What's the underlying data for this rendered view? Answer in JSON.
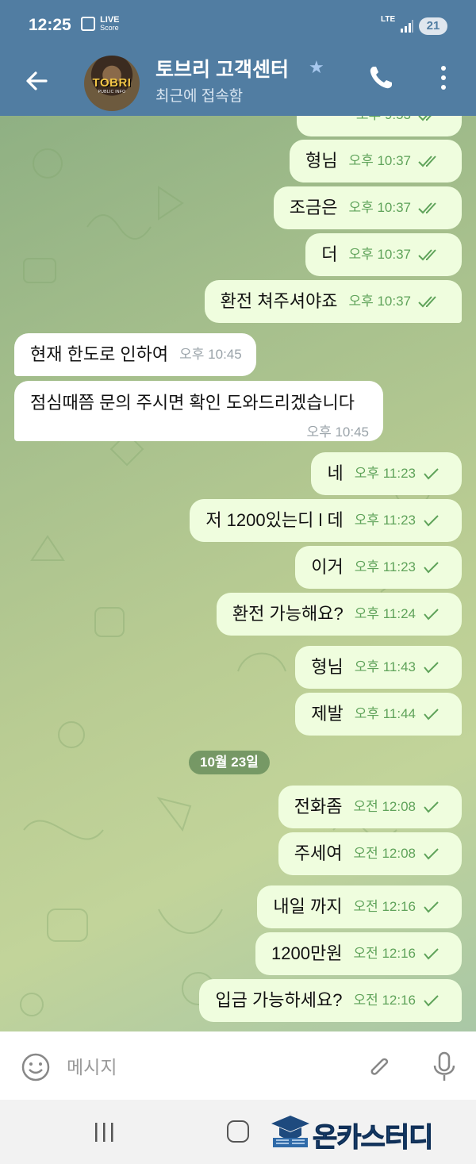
{
  "status_bar": {
    "time": "12:25",
    "live_label_top": "LIVE",
    "live_label_bottom": "Score",
    "network": "LTE",
    "battery": "21"
  },
  "header": {
    "title": "토브리 고객센터",
    "status": "최근에 접속함",
    "avatar_text": "TOBRI",
    "avatar_subtext": "PUBLIC INFO",
    "colors": {
      "bar": "#517da2"
    }
  },
  "chat": {
    "partial_time": "오후 9:53",
    "date_chip": "10월 23일",
    "messages": [
      {
        "dir": "out",
        "text": "형님",
        "time": "오후 10:37",
        "read": true
      },
      {
        "dir": "out",
        "text": "조금은",
        "time": "오후 10:37",
        "read": true
      },
      {
        "dir": "out",
        "text": "더",
        "time": "오후 10:37",
        "read": true
      },
      {
        "dir": "out",
        "text": "환전 쳐주셔야죠",
        "time": "오후 10:37",
        "read": true
      },
      {
        "dir": "in",
        "text": "현재 한도로 인하여",
        "time": "오후 10:45"
      },
      {
        "dir": "in",
        "text": "점심때쯤 문의 주시면 확인 도와드리겠습니다",
        "time": "오후 10:45"
      },
      {
        "dir": "out",
        "text": "네",
        "time": "오후 11:23",
        "read": false
      },
      {
        "dir": "out",
        "text": "저 1200있는디 l 데",
        "time": "오후 11:23",
        "read": false
      },
      {
        "dir": "out",
        "text": "이거",
        "time": "오후 11:23",
        "read": false
      },
      {
        "dir": "out",
        "text": "환전 가능해요?",
        "time": "오후 11:24",
        "read": false
      },
      {
        "dir": "out",
        "text": "형님",
        "time": "오후 11:43",
        "read": false
      },
      {
        "dir": "out",
        "text": "제발",
        "time": "오후 11:44",
        "read": false
      },
      {
        "dir": "out",
        "text": "전화좀",
        "time": "오전 12:08",
        "read": false
      },
      {
        "dir": "out",
        "text": "주세여",
        "time": "오전 12:08",
        "read": false
      },
      {
        "dir": "out",
        "text": "내일 까지",
        "time": "오전 12:16",
        "read": false
      },
      {
        "dir": "out",
        "text": "1200만원",
        "time": "오전 12:16",
        "read": false
      },
      {
        "dir": "out",
        "text": "입금 가능하세요?",
        "time": "오전 12:16",
        "read": false
      }
    ]
  },
  "input": {
    "placeholder": "메시지"
  },
  "navbar": {
    "brand": "온카스터디"
  }
}
